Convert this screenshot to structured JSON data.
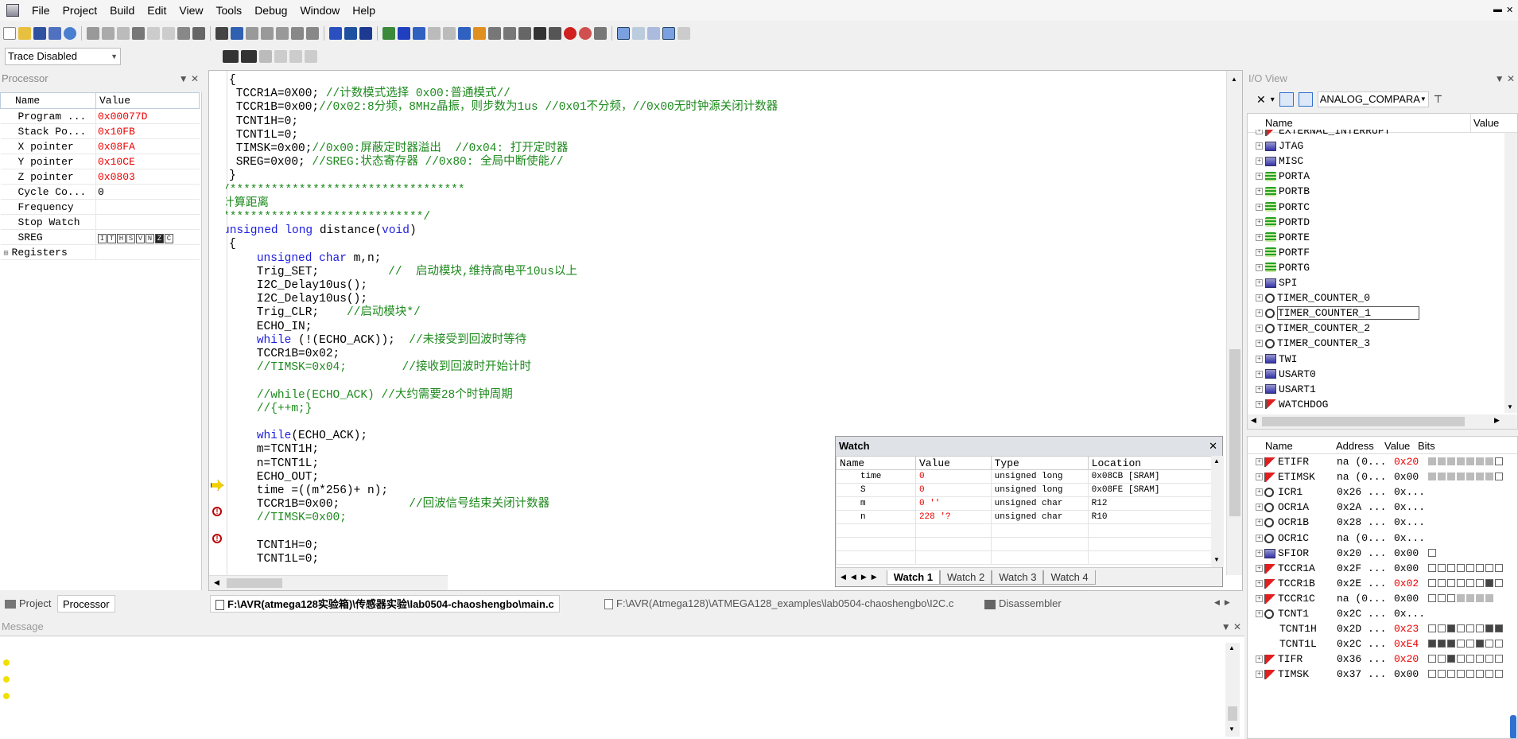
{
  "menu": [
    "File",
    "Project",
    "Build",
    "Edit",
    "View",
    "Tools",
    "Debug",
    "Window",
    "Help"
  ],
  "trace": {
    "value": "Trace Disabled"
  },
  "processor": {
    "title": "Processor",
    "headers": {
      "name": "Name",
      "value": "Value"
    },
    "rows": [
      {
        "name": "Program ...",
        "value": "0x00077D",
        "color": "red"
      },
      {
        "name": "Stack Po...",
        "value": "0x10FB",
        "color": "red"
      },
      {
        "name": "X pointer",
        "value": "0x08FA",
        "color": "red"
      },
      {
        "name": "Y pointer",
        "value": "0x10CE",
        "color": "red"
      },
      {
        "name": "Z pointer",
        "value": "0x0803",
        "color": "red"
      },
      {
        "name": "Cycle Co...",
        "value": "0",
        "color": "black"
      },
      {
        "name": "Frequency",
        "value": "",
        "color": "black"
      },
      {
        "name": "Stop Watch",
        "value": "",
        "color": "black"
      },
      {
        "name": "SREG",
        "value": "",
        "color": "black"
      },
      {
        "name": "Registers",
        "value": "",
        "color": "black"
      }
    ],
    "sreg_bits": [
      "I",
      "T",
      "H",
      "S",
      "V",
      "N",
      "Z",
      "C"
    ]
  },
  "code": [
    {
      "segs": [
        {
          "t": "{",
          "c": ""
        }
      ],
      "indent": 0
    },
    {
      "segs": [
        {
          "t": " TCCR1A=0X00; ",
          "c": ""
        },
        {
          "t": "//计数模式选择 0x00:普通模式//",
          "c": "cm"
        }
      ],
      "indent": 0
    },
    {
      "segs": [
        {
          "t": " TCCR1B=0x00;",
          "c": ""
        },
        {
          "t": "//0x02:8分频，8MHz晶振，则步数为1us //0x01不分频，//0x00无时钟源关闭计数器",
          "c": "cm"
        }
      ],
      "indent": 0
    },
    {
      "segs": [
        {
          "t": " TCNT1H=0;",
          "c": ""
        }
      ],
      "indent": 0
    },
    {
      "segs": [
        {
          "t": " TCNT1L=0;",
          "c": ""
        }
      ],
      "indent": 0
    },
    {
      "segs": [
        {
          "t": " TIMSK=0x00;",
          "c": ""
        },
        {
          "t": "//0x00:屏蔽定时器溢出  //0x04: 打开定时器",
          "c": "cm"
        }
      ],
      "indent": 0
    },
    {
      "segs": [
        {
          "t": " SREG=0x00; ",
          "c": ""
        },
        {
          "t": "//SREG:状态寄存器 //0x80: 全局中断使能//",
          "c": "cm"
        }
      ],
      "indent": 0
    },
    {
      "segs": [
        {
          "t": "}",
          "c": ""
        }
      ],
      "indent": 0
    },
    {
      "segs": [
        {
          "t": "/**********************************",
          "c": "cm"
        }
      ],
      "indent": -1
    },
    {
      "segs": [
        {
          "t": "计算距离",
          "c": "cm"
        }
      ],
      "indent": -1
    },
    {
      "segs": [
        {
          "t": "*****************************/",
          "c": "cm"
        }
      ],
      "indent": -1
    },
    {
      "segs": [
        {
          "t": "unsigned long",
          "c": "kw"
        },
        {
          "t": " distance(",
          "c": ""
        },
        {
          "t": "void",
          "c": "kw"
        },
        {
          "t": ")",
          "c": ""
        }
      ],
      "indent": -1
    },
    {
      "segs": [
        {
          "t": "{",
          "c": ""
        }
      ],
      "indent": 0
    },
    {
      "segs": [
        {
          "t": "    ",
          "c": ""
        },
        {
          "t": "unsigned char",
          "c": "kw"
        },
        {
          "t": " m,n;",
          "c": ""
        }
      ],
      "indent": 0
    },
    {
      "segs": [
        {
          "t": "    Trig_SET;          ",
          "c": ""
        },
        {
          "t": "//  启动模块,维持高电平10us以上",
          "c": "cm"
        }
      ],
      "indent": 0
    },
    {
      "segs": [
        {
          "t": "    I2C_Delay10us();",
          "c": ""
        }
      ],
      "indent": 0
    },
    {
      "segs": [
        {
          "t": "    I2C_Delay10us();",
          "c": ""
        }
      ],
      "indent": 0
    },
    {
      "segs": [
        {
          "t": "    Trig_CLR;    ",
          "c": ""
        },
        {
          "t": "//启动模块*/",
          "c": "cm"
        }
      ],
      "indent": 0
    },
    {
      "segs": [
        {
          "t": "    ECHO_IN;",
          "c": ""
        }
      ],
      "indent": 0
    },
    {
      "segs": [
        {
          "t": "    ",
          "c": ""
        },
        {
          "t": "while",
          "c": "kw"
        },
        {
          "t": " (!(ECHO_ACK));  ",
          "c": ""
        },
        {
          "t": "//未接受到回波时等待",
          "c": "cm"
        }
      ],
      "indent": 0
    },
    {
      "segs": [
        {
          "t": "    TCCR1B=0x02;",
          "c": ""
        }
      ],
      "indent": 0
    },
    {
      "segs": [
        {
          "t": "    ",
          "c": ""
        },
        {
          "t": "//TIMSK=0x04;        //接收到回波时开始计时",
          "c": "cm"
        }
      ],
      "indent": 0
    },
    {
      "segs": [
        {
          "t": "",
          "c": ""
        }
      ],
      "indent": 0
    },
    {
      "segs": [
        {
          "t": "    ",
          "c": ""
        },
        {
          "t": "//while(ECHO_ACK) //大约需要28个时钟周期",
          "c": "cm"
        }
      ],
      "indent": 0
    },
    {
      "segs": [
        {
          "t": "    ",
          "c": ""
        },
        {
          "t": "//{++m;}",
          "c": "cm"
        }
      ],
      "indent": 0
    },
    {
      "segs": [
        {
          "t": "",
          "c": ""
        }
      ],
      "indent": 0
    },
    {
      "segs": [
        {
          "t": "    ",
          "c": ""
        },
        {
          "t": "while",
          "c": "kw"
        },
        {
          "t": "(ECHO_ACK);",
          "c": ""
        }
      ],
      "indent": 0
    },
    {
      "segs": [
        {
          "t": "    m=TCNT1H;",
          "c": ""
        }
      ],
      "indent": 0
    },
    {
      "segs": [
        {
          "t": "    n=TCNT1L;",
          "c": ""
        }
      ],
      "indent": 0
    },
    {
      "segs": [
        {
          "t": "    ECHO_OUT;",
          "c": ""
        }
      ],
      "indent": 0
    },
    {
      "segs": [
        {
          "t": "    time =((m*256)+ n);",
          "c": ""
        }
      ],
      "indent": 0
    },
    {
      "segs": [
        {
          "t": "    TCCR1B=0x00;          ",
          "c": ""
        },
        {
          "t": "//回波信号结束关闭计数器",
          "c": "cm"
        }
      ],
      "indent": 0
    },
    {
      "segs": [
        {
          "t": "    ",
          "c": ""
        },
        {
          "t": "//TIMSK=0x00;",
          "c": "cm"
        }
      ],
      "indent": 0
    },
    {
      "segs": [
        {
          "t": "",
          "c": ""
        }
      ],
      "indent": 0
    },
    {
      "segs": [
        {
          "t": "    TCNT1H=0;",
          "c": ""
        }
      ],
      "indent": 0
    },
    {
      "segs": [
        {
          "t": "    TCNT1L=0;",
          "c": ""
        }
      ],
      "indent": 0
    }
  ],
  "watch": {
    "title": "Watch",
    "headers": [
      "Name",
      "Value",
      "Type",
      "Location"
    ],
    "rows": [
      [
        "time",
        "0",
        "unsigned long",
        "0x08CB [SRAM]"
      ],
      [
        "S",
        "0",
        "unsigned long",
        "0x08FE [SRAM]"
      ],
      [
        "m",
        "0 ''",
        "unsigned char",
        "R12"
      ],
      [
        "n",
        "228 '?",
        "unsigned char",
        "R10"
      ]
    ],
    "tabs": [
      "Watch 1",
      "Watch 2",
      "Watch 3",
      "Watch 4"
    ]
  },
  "io": {
    "title": "I/O View",
    "combo": "ANALOG_COMPARA",
    "headers": {
      "name": "Name",
      "value": "Value"
    },
    "items": [
      {
        "name": "EXTERNAL_INTERRUPT",
        "icon": "flag"
      },
      {
        "name": "JTAG",
        "icon": "block"
      },
      {
        "name": "MISC",
        "icon": "block"
      },
      {
        "name": "PORTA",
        "icon": "port"
      },
      {
        "name": "PORTB",
        "icon": "port"
      },
      {
        "name": "PORTC",
        "icon": "port"
      },
      {
        "name": "PORTD",
        "icon": "port"
      },
      {
        "name": "PORTE",
        "icon": "port"
      },
      {
        "name": "PORTF",
        "icon": "port"
      },
      {
        "name": "PORTG",
        "icon": "port"
      },
      {
        "name": "SPI",
        "icon": "block"
      },
      {
        "name": "TIMER_COUNTER_0",
        "icon": "timer"
      },
      {
        "name": "TIMER_COUNTER_1",
        "icon": "timer"
      },
      {
        "name": "TIMER_COUNTER_2",
        "icon": "timer"
      },
      {
        "name": "TIMER_COUNTER_3",
        "icon": "timer"
      },
      {
        "name": "TWI",
        "icon": "block"
      },
      {
        "name": "USART0",
        "icon": "block"
      },
      {
        "name": "USART1",
        "icon": "block"
      },
      {
        "name": "WATCHDOG",
        "icon": "flag"
      }
    ],
    "reg_headers": [
      "Name",
      "Address",
      "Value",
      "Bits"
    ],
    "registers": [
      {
        "name": "ETIFR",
        "addr": "na (0...",
        "value": "0x20",
        "red": true,
        "icon": "flag",
        "bits": "gggggggo",
        "plus": true
      },
      {
        "name": "ETIMSK",
        "addr": "na (0...",
        "value": "0x00",
        "red": false,
        "icon": "flag",
        "bits": "gggggggo",
        "plus": true
      },
      {
        "name": "ICR1",
        "addr": "0x26 ...",
        "value": "0x...",
        "red": false,
        "icon": "timer",
        "bits": "",
        "plus": true
      },
      {
        "name": "OCR1A",
        "addr": "0x2A ...",
        "value": "0x...",
        "red": false,
        "icon": "timer",
        "bits": "",
        "plus": true
      },
      {
        "name": "OCR1B",
        "addr": "0x28 ...",
        "value": "0x...",
        "red": false,
        "icon": "timer",
        "bits": "",
        "plus": true
      },
      {
        "name": "OCR1C",
        "addr": "na (0...",
        "value": "0x...",
        "red": false,
        "icon": "timer",
        "bits": "",
        "plus": true
      },
      {
        "name": "SFIOR",
        "addr": "0x20 ...",
        "value": "0x00",
        "red": false,
        "icon": "block",
        "bits": "o",
        "plus": true
      },
      {
        "name": "TCCR1A",
        "addr": "0x2F ...",
        "value": "0x00",
        "red": false,
        "icon": "flag",
        "bits": "oooooooo",
        "plus": true
      },
      {
        "name": "TCCR1B",
        "addr": "0x2E ...",
        "value": "0x02",
        "red": true,
        "icon": "flag",
        "bits": "oooooo1o",
        "plus": true
      },
      {
        "name": "TCCR1C",
        "addr": "na (0...",
        "value": "0x00",
        "red": false,
        "icon": "flag",
        "bits": "ooogggg",
        "plus": true
      },
      {
        "name": "TCNT1",
        "addr": "0x2C ...",
        "value": "0x...",
        "red": false,
        "icon": "timer",
        "bits": "",
        "plus": true
      },
      {
        "name": "TCNT1H",
        "addr": "0x2D ...",
        "value": "0x23",
        "red": true,
        "icon": "",
        "bits": "oo1ooo11",
        "plus": false
      },
      {
        "name": "TCNT1L",
        "addr": "0x2C ...",
        "value": "0xE4",
        "red": true,
        "icon": "",
        "bits": "111oo1oo",
        "plus": false
      },
      {
        "name": "TIFR",
        "addr": "0x36 ...",
        "value": "0x20",
        "red": true,
        "icon": "flag",
        "bits": "oo1ooooo",
        "plus": true
      },
      {
        "name": "TIMSK",
        "addr": "0x37 ...",
        "value": "0x00",
        "red": false,
        "icon": "flag",
        "bits": "oooooooo",
        "plus": true
      }
    ]
  },
  "tabs": {
    "left": [
      "Project",
      "Processor"
    ],
    "editor": [
      "F:\\AVR(atmega128实验箱)\\传感器实验\\lab0504-chaoshengbo\\main.c",
      "F:\\AVR(Atmega128)\\ATMEGA128_examples\\lab0504-chaoshengbo\\I2C.c",
      "Disassembler"
    ]
  },
  "message": {
    "title": "Message"
  },
  "colors": {
    "keyword": "#1c1ce0",
    "comment": "#1e8a1e",
    "changed": "#e00000"
  }
}
